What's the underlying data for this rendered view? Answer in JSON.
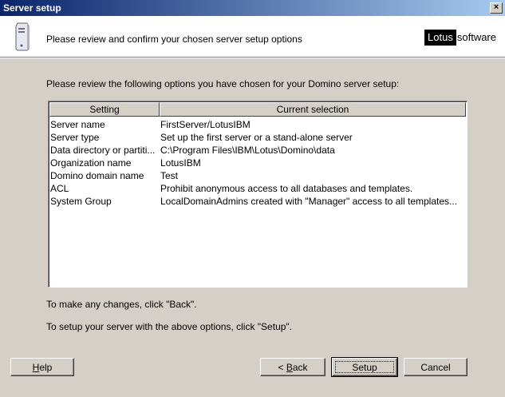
{
  "window": {
    "title": "Server setup",
    "close_glyph": "×"
  },
  "header": {
    "text": "Please review and confirm your chosen server setup options",
    "logo_part1": "Lotus",
    "logo_part2": "software",
    "icon": "server-icon"
  },
  "instruction": "Please review the following options you have chosen for your Domino server setup:",
  "table": {
    "columns": [
      "Setting",
      "Current selection"
    ],
    "rows": [
      {
        "setting": "Server name",
        "value": "FirstServer/LotusIBM"
      },
      {
        "setting": "Server type",
        "value": "Set up the first server or a stand-alone server"
      },
      {
        "setting": "Data directory or partiti...",
        "value": "C:\\Program Files\\IBM\\Lotus\\Domino\\data"
      },
      {
        "setting": "Organization name",
        "value": "LotusIBM"
      },
      {
        "setting": "Domino domain name",
        "value": "Test"
      },
      {
        "setting": "ACL",
        "value": "Prohibit  anonymous access to all databases and templates."
      },
      {
        "setting": "System Group",
        "value": "LocalDomainAdmins created with \"Manager\" access to all templates..."
      }
    ]
  },
  "notes": {
    "back_note": "To make any changes, click \"Back\".",
    "setup_note": "To setup your server with the above options, click \"Setup\"."
  },
  "buttons": {
    "help_mnemonic": "H",
    "help_rest": "elp",
    "back_arrow": "< ",
    "back_mnemonic": "B",
    "back_rest": "ack",
    "setup": "Setup",
    "cancel": "Cancel"
  },
  "colors": {
    "titlebar_start": "#0a246a",
    "titlebar_end": "#a6caf0",
    "face": "#d4d0c8"
  }
}
